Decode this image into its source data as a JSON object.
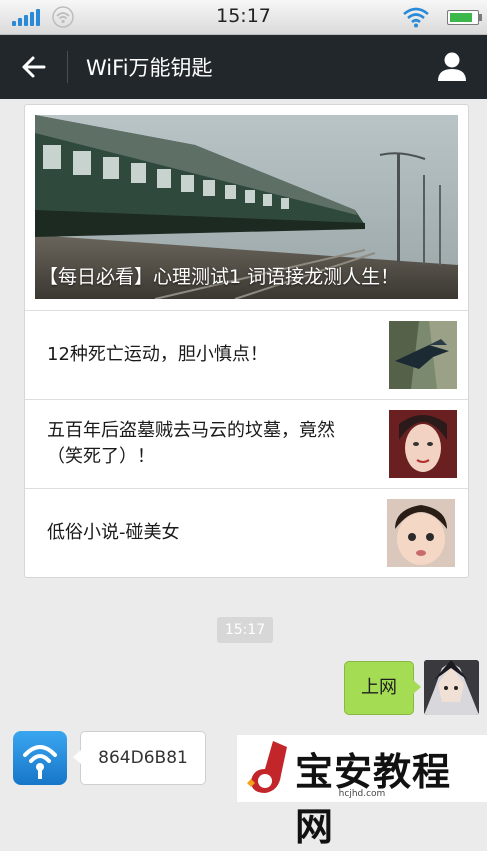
{
  "status_bar": {
    "time": "15:17",
    "signal_icon": "cellular-signal-icon",
    "wifi_icon": "wifi-icon",
    "battery_icon": "battery-icon"
  },
  "header": {
    "title": "WiFi万能钥匙",
    "back_icon": "back-arrow-icon",
    "profile_icon": "user-profile-icon"
  },
  "articles": {
    "featured": {
      "title": "【每日必看】心理测试1 词语接龙测人生！"
    },
    "items": [
      {
        "title": "12种死亡运动，胆小慎点！"
      },
      {
        "title": "五百年后盗墓贼去马云的坟墓，竟然（笑死了）！"
      },
      {
        "title": "低俗小说-碰美女"
      }
    ]
  },
  "chat": {
    "timestamp": "15:17",
    "outgoing": {
      "text": "上网"
    },
    "incoming": {
      "text": "864D6B81"
    }
  },
  "watermark": {
    "text": "宝安教程网",
    "url": "hcjhd.com"
  },
  "colors": {
    "header_bg": "#22272b",
    "outgoing_bubble": "#a4dc54",
    "app_icon_blue": "#1e88d8"
  }
}
